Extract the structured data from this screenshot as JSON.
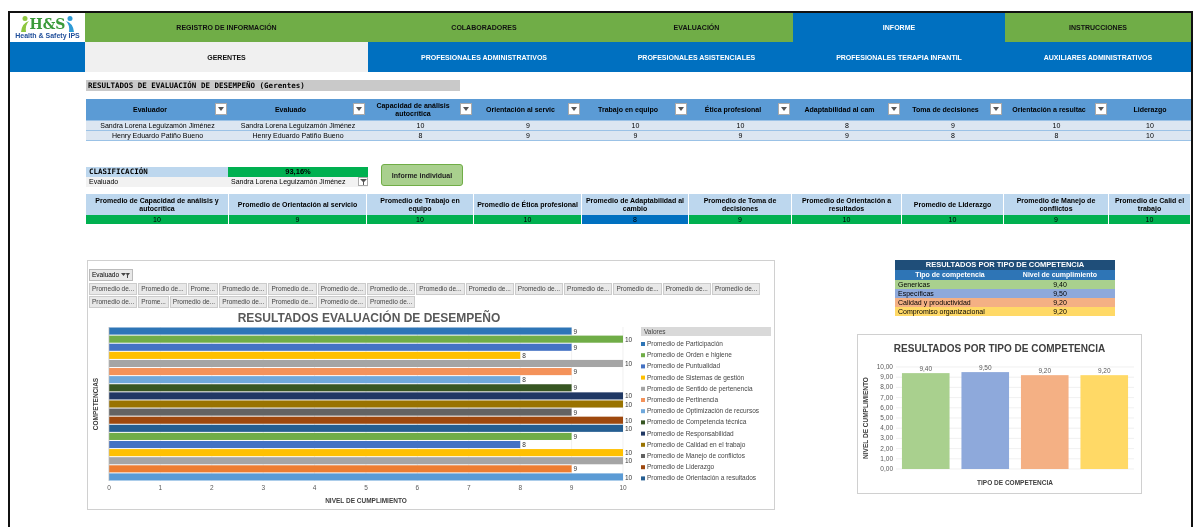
{
  "logo": {
    "mark": "H&S",
    "tagline": "Health & Safety IPS"
  },
  "main_tabs": [
    {
      "label": "REGISTRO DE INFORMACIÓN",
      "selected": false
    },
    {
      "label": "COLABORADORES",
      "selected": false
    },
    {
      "label": "EVALUACIÓN",
      "selected": false
    },
    {
      "label": "INFORME",
      "selected": true
    },
    {
      "label": "INSTRUCCIONES",
      "selected": false
    }
  ],
  "sub_tabs": [
    {
      "label": "GERENTES",
      "selected": true
    },
    {
      "label": "PROFESIONALES ADMINISTRATIVOS",
      "selected": false
    },
    {
      "label": "PROFESIONALES ASISTENCIALES",
      "selected": false
    },
    {
      "label": "PROFESIONALES TERAPIA INFANTIL",
      "selected": false
    },
    {
      "label": "AUXILIARES ADMINISTRATIVOS",
      "selected": false
    }
  ],
  "report_title": "RESULTADOS DE EVALUACIÓN DE DESEMPEÑO (Gerentes)",
  "table": {
    "columns": [
      {
        "label": "Evaluador",
        "filter": true
      },
      {
        "label": "Evaluado",
        "filter": true
      },
      {
        "label": "Capacidad de análisis autocrítica",
        "filter": true
      },
      {
        "label": "Orientación al servic",
        "filter": true
      },
      {
        "label": "Trabajo en equipo",
        "filter": true
      },
      {
        "label": "Ética profesional",
        "filter": true
      },
      {
        "label": "Adaptabilidad al cam",
        "filter": true
      },
      {
        "label": "Toma de decisiones",
        "filter": true
      },
      {
        "label": "Orientación a resultac",
        "filter": true
      },
      {
        "label": "Liderazgo",
        "filter": false
      }
    ],
    "rows": [
      [
        "Sandra Lorena Leguizamón Jiménez",
        "Sandra Lorena Leguizamón Jiménez",
        "10",
        "9",
        "10",
        "10",
        "8",
        "9",
        "10",
        "10"
      ],
      [
        "Henry Eduardo Patiño Bueno",
        "Henry Eduardo Patiño Bueno",
        "8",
        "9",
        "9",
        "9",
        "9",
        "8",
        "8",
        "10"
      ]
    ]
  },
  "classification": {
    "label": "CLASIFICACIÓN",
    "value": "93,16%",
    "evaluado_label": "Evaluado",
    "evaluado_value": "Sandra Lorena Leguizamón Jiménez"
  },
  "report_button": "Informe individual",
  "averages": [
    {
      "label": "Promedio de Capacidad de análisis y autocrítica",
      "value": "10",
      "color": "#00b050"
    },
    {
      "label": "Promedio de Orientación al servicio",
      "value": "9",
      "color": "#00b050"
    },
    {
      "label": "Promedio de Trabajo en equipo",
      "value": "10",
      "color": "#00b050"
    },
    {
      "label": "Promedio de Ética profesional",
      "value": "10",
      "color": "#00b050"
    },
    {
      "label": "Promedio de Adaptabilidad al cambio",
      "value": "8",
      "color": "#0070c0"
    },
    {
      "label": "Promedio de Toma de decisiones",
      "value": "9",
      "color": "#00b050"
    },
    {
      "label": "Promedio de Orientación a resultados",
      "value": "10",
      "color": "#00b050"
    },
    {
      "label": "Promedio de Liderazgo",
      "value": "10",
      "color": "#00b050"
    },
    {
      "label": "Promedio de Manejo de conflictos",
      "value": "9",
      "color": "#00b050"
    },
    {
      "label": "Promedio de Calid el trabajo",
      "value": "10",
      "color": "#00b050"
    }
  ],
  "pivot": {
    "filter_label": "Evaluado",
    "fields": [
      "Promedio de...",
      "Promedio de...",
      "Prome...",
      "Promedio de...",
      "Promedio de...",
      "Promedio de...",
      "Promedio de...",
      "Promedio de...",
      "Promedio de...",
      "Promedio de...",
      "Promedio de...",
      "Promedio de...",
      "Promedio de...",
      "Promedio de...",
      "Promedio de...",
      "Prome...",
      "Promedio de...",
      "Promedio de...",
      "Promedio de...",
      "Promedio de...",
      "Promedio de..."
    ]
  },
  "performance_chart": {
    "legend_title": "Valores",
    "chart_data": {
      "type": "bar",
      "orientation": "horizontal",
      "grid": true,
      "legend": "right",
      "title": "RESULTADOS EVALUACIÓN DE DESEMPEÑO",
      "xlabel": "NIVEL DE CUMPLIMIENTO",
      "ylabel": "COMPETENCIAS",
      "xlim": [
        0,
        10
      ],
      "xticks": [
        0,
        1,
        2,
        3,
        4,
        5,
        6,
        7,
        8,
        9,
        10
      ],
      "data_labels": true,
      "series": [
        {
          "name": "Promedio de Participación",
          "color": "#2e75b6",
          "values": [
            9
          ]
        },
        {
          "name": "Promedio de Orden e higiene",
          "color": "#70ad47",
          "values": [
            10
          ]
        },
        {
          "name": "Promedio de Puntualidad",
          "color": "#4472c4",
          "values": [
            9
          ]
        },
        {
          "name": "Promedio de Sistemas de gestión",
          "color": "#ffc000",
          "values": [
            8
          ]
        },
        {
          "name": "Promedio de Sentido de pertenencia",
          "color": "#a5a5a5",
          "values": [
            10
          ]
        },
        {
          "name": "Promedio de Pertinencia",
          "color": "#f4925a",
          "values": [
            9
          ]
        },
        {
          "name": "Promedio de Optimización de recursos",
          "color": "#6fa8dc",
          "values": [
            8
          ]
        },
        {
          "name": "Promedio de Competencia técnica",
          "color": "#375623",
          "values": [
            9
          ]
        },
        {
          "name": "Promedio de Responsabilidad",
          "color": "#203864",
          "values": [
            10
          ]
        },
        {
          "name": "Promedio de Calidad en el trabajo",
          "color": "#997300",
          "values": [
            10
          ]
        },
        {
          "name": "Promedio de Manejo de conflictos",
          "color": "#636363",
          "values": [
            9
          ]
        },
        {
          "name": "Promedio de Liderazgo",
          "color": "#9e480e",
          "values": [
            10
          ]
        },
        {
          "name": "Promedio de Orientación a resultados",
          "color": "#255e91",
          "values": [
            10
          ]
        },
        {
          "color": "#70ad47",
          "values": [
            9
          ]
        },
        {
          "color": "#4472c4",
          "values": [
            8
          ]
        },
        {
          "color": "#ffc000",
          "values": [
            10
          ]
        },
        {
          "color": "#a5a5a5",
          "values": [
            10
          ]
        },
        {
          "color": "#ed7d31",
          "values": [
            9
          ]
        },
        {
          "color": "#5b9bd5",
          "values": [
            10
          ]
        }
      ]
    }
  },
  "competency_table": {
    "title": "RESULTADOS POR TIPO DE COMPETENCIA",
    "columns": [
      "Tipo de competencia",
      "Nivel de cumplimiento"
    ],
    "rows": [
      {
        "name": "Genericas",
        "value": "9,40",
        "color": "#a9d08e"
      },
      {
        "name": "Específicas",
        "value": "9,50",
        "color": "#8ea9db"
      },
      {
        "name": "Calidad y productividad",
        "value": "9,20",
        "color": "#f4b084"
      },
      {
        "name": "Compromiso organizacional",
        "value": "9,20",
        "color": "#ffd966"
      }
    ]
  },
  "competency_chart": {
    "chart_data": {
      "type": "bar",
      "title": "RESULTADOS POR TIPO DE COMPETENCIA",
      "xlabel": "TIPO DE COMPETENCIA",
      "ylabel": "NIVEL DE CUMPLIMIENTO",
      "grid": true,
      "ylim": [
        0,
        10
      ],
      "yticks": [
        {
          "value": 0,
          "label": "0,00"
        },
        {
          "value": 1,
          "label": "1,00"
        },
        {
          "value": 2,
          "label": "2,00"
        },
        {
          "value": 3,
          "label": "3,00"
        },
        {
          "value": 4,
          "label": "4,00"
        },
        {
          "value": 5,
          "label": "5,00"
        },
        {
          "value": 6,
          "label": "6,00"
        },
        {
          "value": 7,
          "label": "7,00"
        },
        {
          "value": 8,
          "label": "8,00"
        },
        {
          "value": 9,
          "label": "9,00"
        },
        {
          "value": 10,
          "label": "10,00"
        }
      ],
      "data_labels": true,
      "series": [
        {
          "values": [
            9.4,
            9.5,
            9.2,
            9.2
          ],
          "colors": [
            "#a9d08e",
            "#8ea9db",
            "#f4b084",
            "#ffd966"
          ],
          "value_labels": [
            "9,40",
            "9,50",
            "9,20",
            "9,20"
          ]
        }
      ]
    }
  }
}
